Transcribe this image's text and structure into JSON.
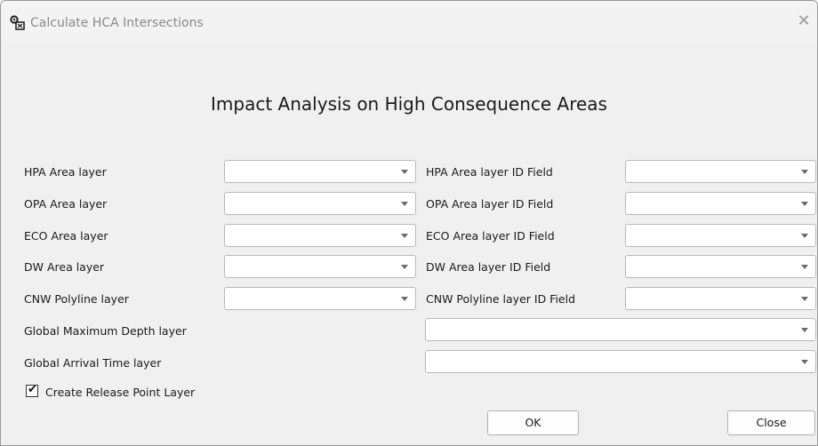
{
  "window": {
    "title": "Calculate HCA Intersections",
    "icon": "gear-tool-icon",
    "close_glyph": "✕"
  },
  "heading": "Impact Analysis on High Consequence Areas",
  "layers_left": [
    {
      "label": "HPA Area layer",
      "value": ""
    },
    {
      "label": "OPA Area layer",
      "value": ""
    },
    {
      "label": "ECO Area layer",
      "value": ""
    },
    {
      "label": "DW Area layer",
      "value": ""
    },
    {
      "label": "CNW Polyline layer",
      "value": ""
    }
  ],
  "fields_right": [
    {
      "label": "HPA Area layer ID Field",
      "value": ""
    },
    {
      "label": "OPA Area layer ID Field",
      "value": ""
    },
    {
      "label": "ECO Area layer ID Field",
      "value": ""
    },
    {
      "label": "DW Area layer ID Field",
      "value": ""
    },
    {
      "label": "CNW Polyline layer ID Field",
      "value": ""
    }
  ],
  "global_layers": [
    {
      "label": "Global Maximum Depth layer",
      "value": ""
    },
    {
      "label": "Global Arrival Time layer",
      "value": ""
    }
  ],
  "release_point": {
    "label": "Create Release Point Layer",
    "checked": true,
    "check_glyph": "✔"
  },
  "buttons": {
    "ok": "OK",
    "close": "Close"
  }
}
